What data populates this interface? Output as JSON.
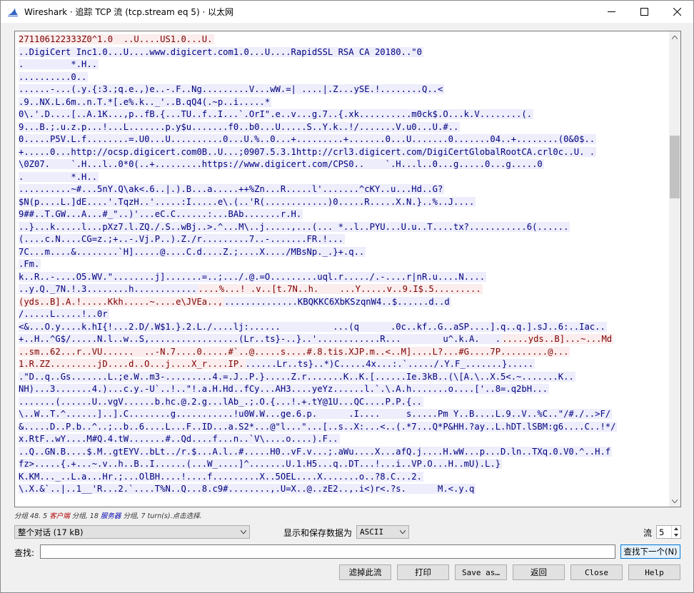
{
  "window": {
    "title": "Wireshark · 追踪 TCP 流 (tcp.stream eq 5) · 以太网"
  },
  "stream_lines": [
    {
      "t": "c",
      "text": "271106122333Z0^1.0  ..U....US1.0...U."
    },
    {
      "t": "s",
      "text": "..DigiCert Inc1.0...U....www.digicert.com1.0...U....RapidSSL RSA CA 20180..\"0"
    },
    {
      "t": "s",
      "text": ".         *.H.."
    },
    {
      "t": "s",
      "text": "..........0.."
    },
    {
      "t": "s",
      "text": "......-...(.y.{:3.;q.e.,)e..-.F..Ng.........V...wW.=| ....|.Z...ySE.!........Q..<"
    },
    {
      "t": "s",
      "text": ".9..NX.L.6m..n.T.*[.e%.k.._'..B.qQ4(.~p..i.....*"
    },
    {
      "t": "s",
      "text": "0\\.'.D....[..A.1K...,p..fB.{...TU..f..I...`.OrI\".e..v...g.7..{.xk..........m0ck$.O...k.V........(."
    },
    {
      "t": "s",
      "text": "9...B.;.u.z.p...!...L.......p.y$u.......f0..b0...U.....S..Y.k..!/.......V.u0...U.#.."
    },
    {
      "t": "s",
      "text": "0.....P5V.L.f........=.U0...U..........0...U.%..0...+.........+.......0...U.......0.......04..+........(0&0$.."
    },
    {
      "t": "s",
      "text": "+.....0...http://ocsp.digicert.com0B..U...;0907.5.3.1http://crl3.digicert.com/DigiCertGlobalRootCA.crl0c..U. ."
    },
    {
      "t": "s",
      "text": "\\0Z07.    `.H...l..0*0(..+.........https://www.digicert.com/CPS0..    `.H...l..0...g.....0...g.....0"
    },
    {
      "t": "s",
      "text": ".         *.H.."
    },
    {
      "t": "s",
      "text": "..........~#...5nY.Q\\ak<.6..|.).B...a.....++%Zn...R.....l'.......^cKY..u...Hd..G?"
    },
    {
      "t": "s",
      "text": "$N(p....L.]dE....'.TqzH..'.....:I.....e\\.(..'R(............)0.....R.....X.N.}..%..J...."
    },
    {
      "t": "s",
      "text": "9##..T.GW...A...#_\"..)'...eC.C......:...BAb.......r.H."
    },
    {
      "t": "s",
      "text": "..}...k.....l...pXz7.l.ZQ./.S..wBj..>.^...M\\..j.....,...(... *..l..PYU...U.u..T....tx?...........6(......"
    },
    {
      "t": "s",
      "text": "(....c.N....CG=z.;+..-.Vj.P..).Z./r.........7..-.......FR.!..."
    },
    {
      "t": "s",
      "text": "7C...m....&........`H].....@....C.d....Z.;....X..../MBsNp._.}+.q.."
    },
    {
      "t": "s",
      "text": ".Fm."
    },
    {
      "t": "s",
      "text": "k..R..-....O5.WV.\"........j].......=..;.../.@.=O.........uql.r...../.-....r|nR.u....N...."
    },
    {
      "t": "m",
      "a": "..y.Q._7N.!.3........h............",
      "b": "....%...! .v..[t.7N..h.    ...Y.....v..9.I$.5........."
    },
    {
      "t": "m2",
      "a": "(yds..B].A.!.....Kkh.....~....e\\JVEa..,",
      "b": "..............KBQKKC6XbKSzqnW4..$......d..d"
    },
    {
      "t": "s",
      "text": "/.....L.....!..0r"
    },
    {
      "t": "s",
      "text": "<&...O.y....k.hI{!...2.D/.W$1.}.2.L./....lj:......          ...(q      .0c..kf..G..aSP....].q..q.].sJ..6:..Iac.."
    },
    {
      "t": "m3",
      "a": "+..H..^G$/.....N.l..w..S,.................(Lr..ts}-..}..'............R...        u^.k.A.   .",
      "b": ".....yds..B]...~...Md"
    },
    {
      "t": "c",
      "text": "..sm..62...r..VU......  ..-N.7....0.....#`..@.....s....#.8.tis.XJP.m..<..M]....L?...#G....7P.........@..."
    },
    {
      "t": "m4",
      "a": "1.R.ZZ.........jD....d..O...j....X_r....IP.",
      "b": "......Lr..ts}..*)C.....4x...:.`...../.Y.F_.......}....."
    },
    {
      "t": "s",
      "text": ".\"D..q..Gs.......L.;e.W..m3-.........4.=.J..P.}.....Z.r.......K..K.[......Ie.3kB..(\\[A.\\..X.5<.~.......K.."
    },
    {
      "t": "s",
      "text": "NH)...3.......4.)...c.y.-U`..!..\"!.a.H.Hd..fCy...AH3....yeYz......l.`.\\.A.h.......o....['..8=.q2bH..."
    },
    {
      "t": "s",
      "text": ".......(......U..vgV......b.hc.@.2.g...lAb_.;.O.{...!.+.tY@1U...QC....P.P.{.."
    },
    {
      "t": "s",
      "text": "\\..W..T.^......]..].C........g...........!u0W.W...ge.6.p.      .I....     s.....Pm Y..B....L.9..V..%C..\"/#./..>F/"
    },
    {
      "t": "s",
      "text": "&.....D..P.b..^..;..b..6....L...F..ID...a.S2*...@\"l...\"...[..s..X:...<..(.*7...Q*P&HH.?ay..L.hDT.lSBM:g6....C..!*/"
    },
    {
      "t": "s",
      "text": "x.RtF..wY....M#Q.4.tW.......#..Qd....f...n..`V\\....o....).F.."
    },
    {
      "t": "s",
      "text": "..Q..GN.B....$.M..gtEYV..bLt../r.$...A.l..#.....H0..vF.v...;.aWu....X...afQ.j....H.wW...p...D.ln..TXq.0.V0.^..H.f"
    },
    {
      "t": "s",
      "text": "fz>.....{.+...~.v..h..B..I......(...W_....]^.......U.1.H5...q..DT...!...i..VP.O...H..mU).L.}"
    },
    {
      "t": "s",
      "text": "K.KM..._..L.a...Hr.;...OlBH....!....f.........X..5OEL....X.......o..?8.C...2."
    },
    {
      "t": "s",
      "text": "\\.X.&`..|..1__'R...2.`....T%N..Q...8.c9#........,.U=X..@..zE2..,.i<)r<.?s.      M.<.y.q"
    }
  ],
  "status": {
    "prefix": "分组 48. 5 ",
    "client_word": "客户端",
    "mid1": " 分组, 18 ",
    "server_word": "服务器",
    "suffix": " 分组, 7 turn(s).点击选择."
  },
  "controls": {
    "conversation_select": "整个对话 (17 kB)",
    "show_save_label": "显示和保存数据为",
    "format_select": "ASCII",
    "stream_label": "流",
    "stream_number": "5",
    "find_label": "查找:",
    "find_value": "",
    "find_next_button": "查找下一个(N)"
  },
  "buttons": {
    "filter_out": "滤掉此流",
    "print": "打印",
    "save_as": "Save as…",
    "back": "返回",
    "close": "Close",
    "help": "Help"
  },
  "colors": {
    "client_bg": "#fbeded",
    "client_fg": "#7f0000",
    "server_bg": "#ededfb",
    "server_fg": "#00007f"
  }
}
